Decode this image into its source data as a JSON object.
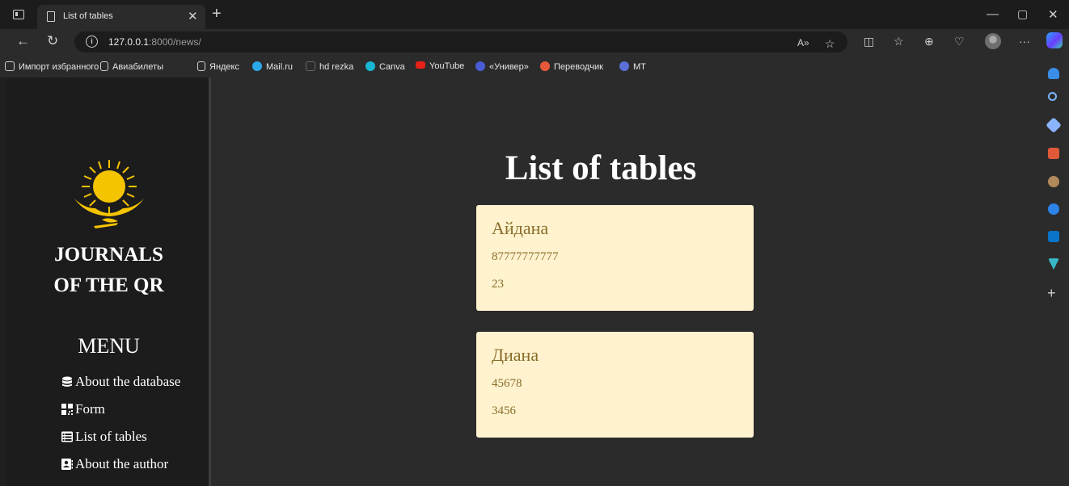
{
  "browser": {
    "tab_title": "List of tables",
    "url_host": "127.0.0.1",
    "url_path": ":8000/news/",
    "bookmarks": [
      {
        "label": "Импорт избранного",
        "icon": "import-icon"
      },
      {
        "label": "Авиабилеты",
        "icon": "page-icon"
      },
      {
        "label": "Яндекс",
        "icon": "page-icon"
      },
      {
        "label": "Mail.ru",
        "icon": "mailru-icon"
      },
      {
        "label": "hd rezka",
        "icon": "hdrezka-icon"
      },
      {
        "label": "Canva",
        "icon": "canva-icon"
      },
      {
        "label": "YouTube",
        "icon": "youtube-icon"
      },
      {
        "label": "«Универ»",
        "icon": "univer-icon"
      },
      {
        "label": "Переводчик",
        "icon": "translator-icon"
      },
      {
        "label": "MT",
        "icon": "teams-icon"
      }
    ]
  },
  "sidebar": {
    "brand_line1": "JOURNALS",
    "brand_line2": "OF THE QR",
    "menu_heading": "MENU",
    "menu_items": [
      {
        "label": "About the database",
        "icon": "database-icon"
      },
      {
        "label": "Form",
        "icon": "qr-icon"
      },
      {
        "label": "List of tables",
        "icon": "table-icon"
      },
      {
        "label": "About the author",
        "icon": "contact-card-icon"
      }
    ]
  },
  "main": {
    "title": "List of tables",
    "records": [
      {
        "name": "Айдана",
        "phone": "87777777777",
        "number": "23"
      },
      {
        "name": "Диана",
        "phone": "45678",
        "number": "3456"
      }
    ]
  },
  "colors": {
    "card_bg": "#fff3cf",
    "card_text": "#8a6d2a",
    "emblem_gold": "#f5c400",
    "page_bg": "#2b2b2b",
    "nav_bg": "#1c1c1c"
  }
}
